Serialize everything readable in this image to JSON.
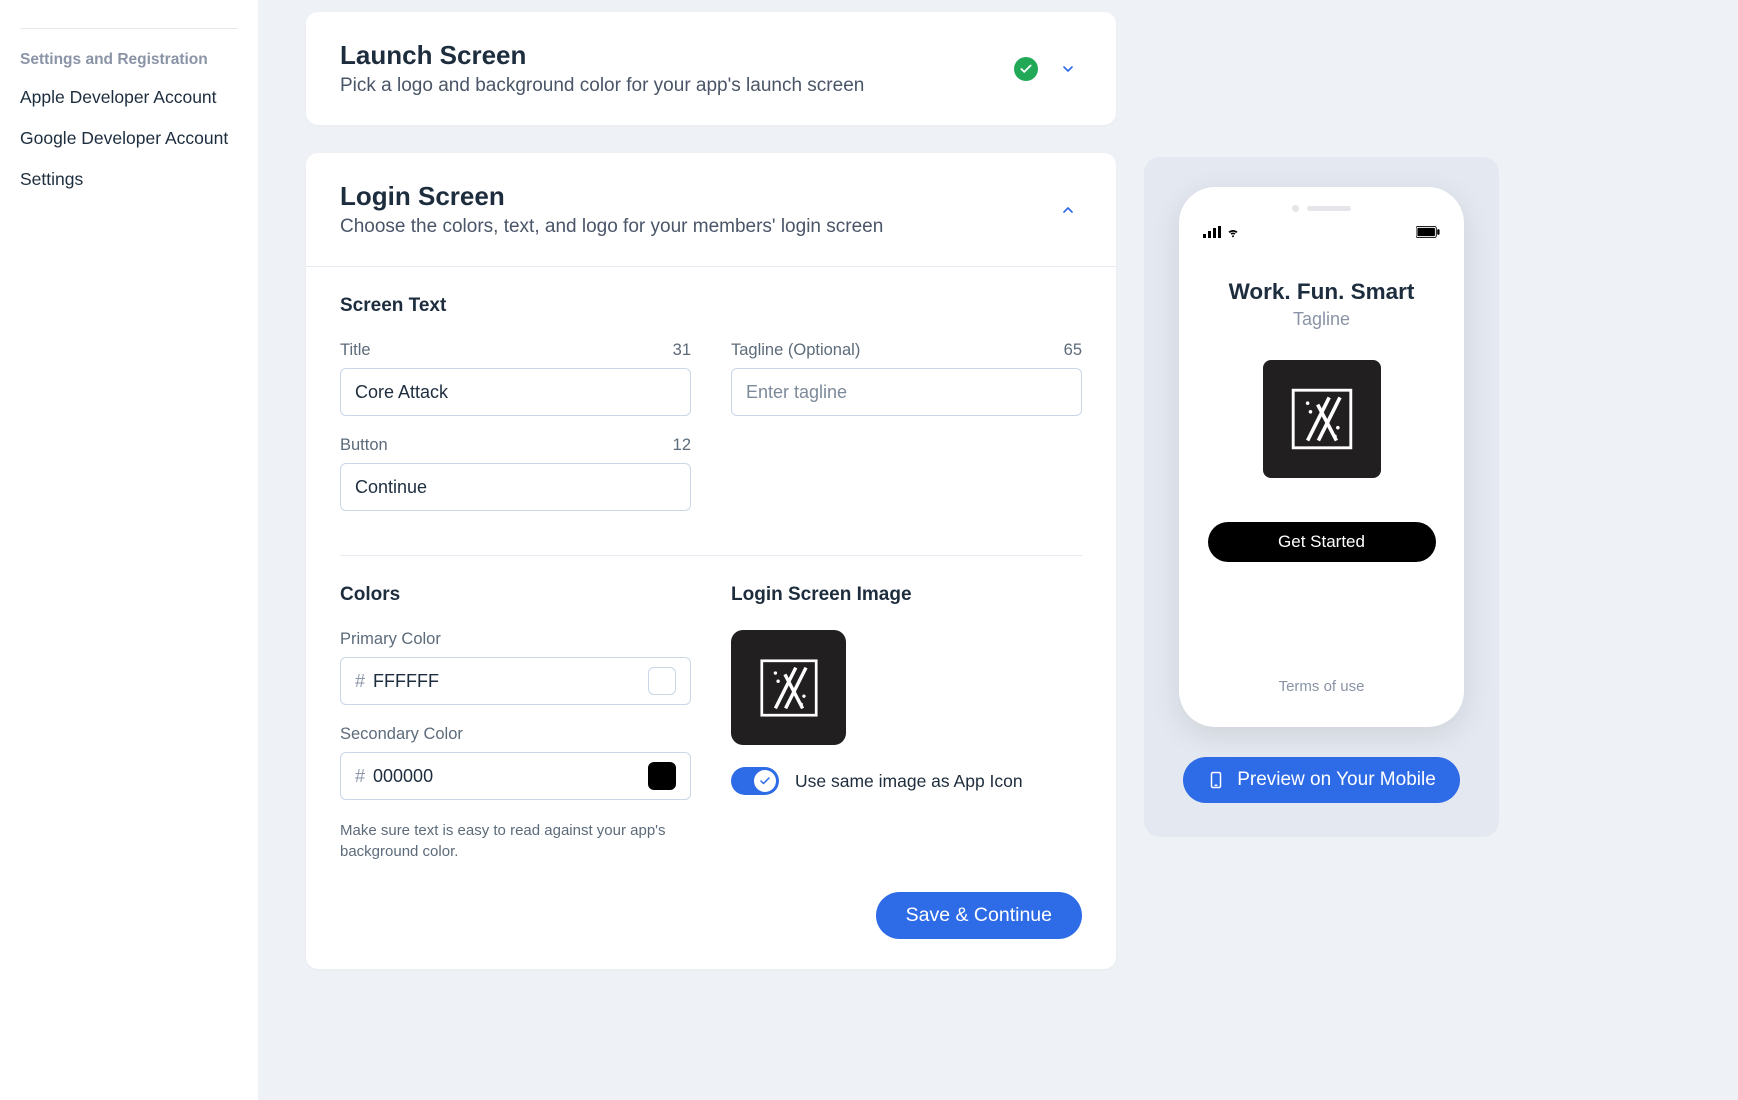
{
  "sidebar": {
    "heading": "Settings and Registration",
    "items": [
      {
        "label": "Apple Developer Account"
      },
      {
        "label": "Google Developer Account"
      },
      {
        "label": "Settings"
      }
    ]
  },
  "launchCard": {
    "title": "Launch Screen",
    "subtitle": "Pick a logo and background color for your app's launch screen"
  },
  "loginCard": {
    "title": "Login Screen",
    "subtitle": "Choose the colors, text, and logo for your members' login screen",
    "screenTextHeading": "Screen Text",
    "titleField": {
      "label": "Title",
      "count": "31",
      "value": "Core Attack"
    },
    "taglineField": {
      "label": "Tagline (Optional)",
      "count": "65",
      "placeholder": "Enter tagline",
      "value": ""
    },
    "buttonField": {
      "label": "Button",
      "count": "12",
      "value": "Continue"
    },
    "colorsHeading": "Colors",
    "primary": {
      "label": "Primary Color",
      "value": "FFFFFF",
      "swatch": "#ffffff"
    },
    "secondary": {
      "label": "Secondary Color",
      "value": "000000",
      "swatch": "#000000"
    },
    "colorHelper": "Make sure text is easy to read against your app's background color.",
    "imageHeading": "Login Screen Image",
    "toggleLabel": "Use same image as App Icon",
    "save": "Save & Continue"
  },
  "preview": {
    "title": "Work. Fun. Smart",
    "tagline": "Tagline",
    "cta": "Get Started",
    "terms": "Terms of use",
    "button": "Preview on Your Mobile"
  },
  "colors": {
    "accent": "#2e6be6",
    "success": "#22a958"
  }
}
